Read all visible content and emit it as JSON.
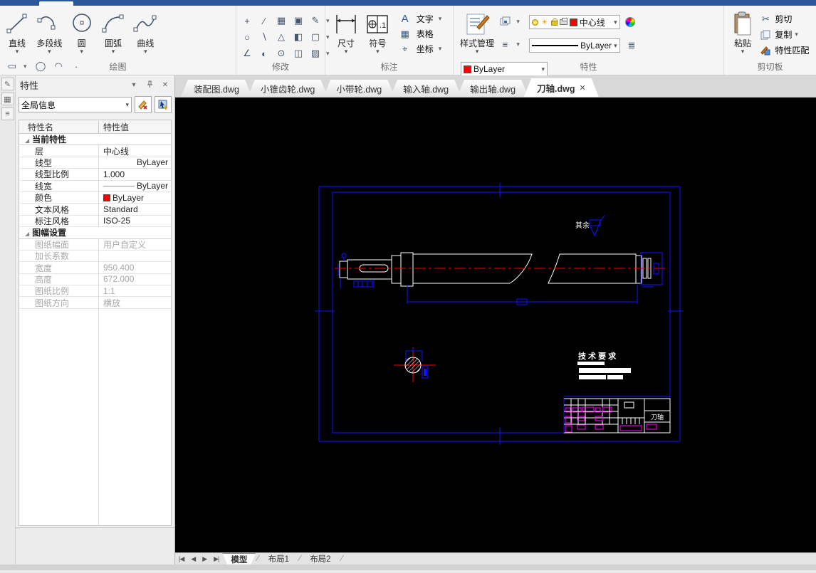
{
  "colors": {
    "titlebar_blue": "#2b579a",
    "canvas_black": "#000000",
    "frame_blue": "#1414ff",
    "centerline_red": "#ff0000",
    "entity_white": "#ffffff",
    "annotation_magenta": "#ff00ff",
    "bylayer_swatch_red": "#ff0000"
  },
  "ribbon": {
    "draw": {
      "label": "绘图",
      "big": [
        {
          "label": "直线"
        },
        {
          "label": "多段线"
        },
        {
          "label": "圆"
        },
        {
          "label": "圆弧"
        },
        {
          "label": "曲线"
        }
      ]
    },
    "modify": {
      "label": "修改"
    },
    "annotate": {
      "label": "标注",
      "dim": "尺寸",
      "sym": "符号",
      "text": "文字",
      "table": "表格",
      "coord": "坐标"
    },
    "props": {
      "label": "特性",
      "style_mgr": "样式管理",
      "layer_value": "中心线",
      "color_value": "ByLayer",
      "linetype_value": "ByLayer",
      "linetype2_value": "ByLayer"
    },
    "clipboard": {
      "label": "剪切板",
      "paste": "粘贴",
      "cut": "剪切",
      "copy": "复制",
      "match": "特性匹配"
    }
  },
  "icons": {
    "dropdown": "▾",
    "close": "✕",
    "pin": "-□",
    "cut_glyph": "✂",
    "text_tool": "A",
    "coord_glyph": "⌖",
    "menu_lines": "≡",
    "sun": "☀",
    "nav_first": "|◀",
    "nav_prev": "◀",
    "nav_next": "▶",
    "nav_last": "▶|",
    "draw_grid": [
      "▭",
      "◯",
      "◠",
      "·",
      "∥",
      "◉",
      "⌀",
      "▶",
      "╱",
      "▨",
      "✱",
      "◔"
    ],
    "modify_grid": [
      "+",
      "∕",
      "▦",
      "▣",
      "✎",
      "○",
      "∖",
      "△",
      "◧",
      "▢",
      "∠",
      "◐",
      "⊙",
      "◫",
      "▨"
    ],
    "strip_tabs": [
      "✎",
      "▦",
      "≡"
    ]
  },
  "palette": {
    "title": "特性",
    "filter_value": "全局信息",
    "col_name": "特性名",
    "col_value": "特性值",
    "rows": [
      {
        "name": "当前特性",
        "value": "",
        "kind": "group"
      },
      {
        "name": "层",
        "value": "中心线",
        "kind": "text"
      },
      {
        "name": "线型",
        "value": "ByLayer",
        "kind": "linetype"
      },
      {
        "name": "线型比例",
        "value": "1.000",
        "kind": "text"
      },
      {
        "name": "线宽",
        "value": "ByLayer",
        "kind": "lineweight"
      },
      {
        "name": "颜色",
        "value": "ByLayer",
        "kind": "color"
      },
      {
        "name": "文本风格",
        "value": "Standard",
        "kind": "text"
      },
      {
        "name": "标注风格",
        "value": "ISO-25",
        "kind": "text"
      },
      {
        "name": "图幅设置",
        "value": "",
        "kind": "group"
      },
      {
        "name": "图纸幅面",
        "value": "用户自定义",
        "kind": "text",
        "disabled": true
      },
      {
        "name": "加长系数",
        "value": "",
        "kind": "text",
        "disabled": true
      },
      {
        "name": "宽度",
        "value": "950.400",
        "kind": "text",
        "disabled": true
      },
      {
        "name": "高度",
        "value": "672.000",
        "kind": "text",
        "disabled": true
      },
      {
        "name": "图纸比例",
        "value": "1:1",
        "kind": "text",
        "disabled": true
      },
      {
        "name": "图纸方向",
        "value": "横放",
        "kind": "text",
        "disabled": true
      }
    ]
  },
  "doc_tabs": [
    {
      "label": "装配图.dwg"
    },
    {
      "label": "小锥齿轮.dwg"
    },
    {
      "label": "小带轮.dwg"
    },
    {
      "label": "输入轴.dwg"
    },
    {
      "label": "输出轴.dwg"
    },
    {
      "label": "刀轴.dwg",
      "active": true
    }
  ],
  "drawing": {
    "surface_prefix": "其余",
    "tech_req_title": "技 术 要 求",
    "part_name": "刀轴"
  },
  "layout_tabs": {
    "model": "模型",
    "layout1": "布局1",
    "layout2": "布局2"
  }
}
